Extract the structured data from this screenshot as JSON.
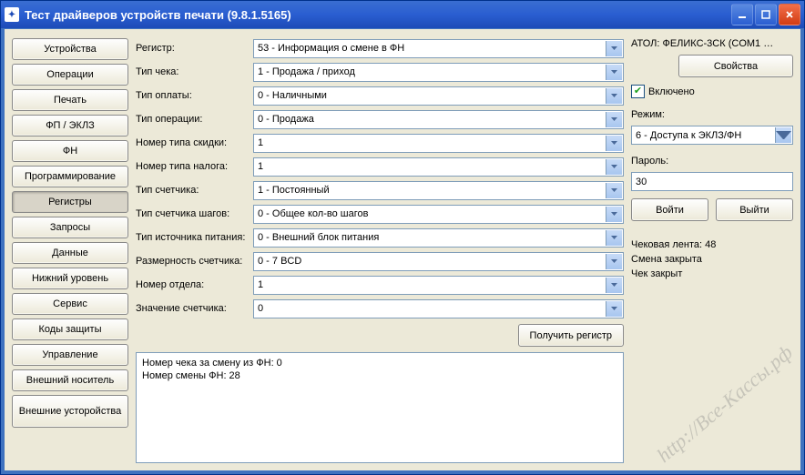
{
  "title": "Тест драйверов устройств печати (9.8.1.5165)",
  "sidebar": [
    "Устройства",
    "Операции",
    "Печать",
    "ФП / ЭКЛЗ",
    "ФН",
    "Программирование",
    "Регистры",
    "Запросы",
    "Данные",
    "Нижний уровень",
    "Сервис",
    "Коды защиты",
    "Управление",
    "Внешний носитель",
    "Внешние усторойства"
  ],
  "sidebar_active_index": 6,
  "form": {
    "rows": [
      {
        "label": "Регистр:",
        "value": "53 - Информация о смене в ФН"
      },
      {
        "label": "Тип чека:",
        "value": "1 - Продажа / приход"
      },
      {
        "label": "Тип оплаты:",
        "value": "0 - Наличными"
      },
      {
        "label": "Тип операции:",
        "value": "0 - Продажа"
      },
      {
        "label": "Номер типа скидки:",
        "value": "1"
      },
      {
        "label": "Номер типа налога:",
        "value": "1"
      },
      {
        "label": "Тип счетчика:",
        "value": "1 - Постоянный"
      },
      {
        "label": "Тип счетчика шагов:",
        "value": "0 - Общее кол-во шагов"
      },
      {
        "label": "Тип источника питания:",
        "value": "0 - Внешний блок питания"
      },
      {
        "label": "Размерность счетчика:",
        "value": "0 - 7 BCD"
      },
      {
        "label": "Номер отдела:",
        "value": "1"
      },
      {
        "label": "Значение счетчика:",
        "value": "0"
      }
    ],
    "action_button": "Получить регистр",
    "log": "Номер чека за смену из ФН: 0\nНомер смены ФН: 28"
  },
  "right": {
    "device_name": "АТОЛ: ФЕЛИКС-3СК (COM1 …",
    "properties_button": "Свойства",
    "enabled_checkbox_label": "Включено",
    "enabled_checked": true,
    "mode_label": "Режим:",
    "mode_value": "6 - Доступа к ЭКЛЗ/ФН",
    "password_label": "Пароль:",
    "password_value": "30",
    "login_button": "Войти",
    "logout_button": "Выйти",
    "status_lines": [
      "Чековая лента: 48",
      "Смена закрыта",
      "Чек закрыт"
    ]
  },
  "watermark": "http://Все-Кассы.рф"
}
